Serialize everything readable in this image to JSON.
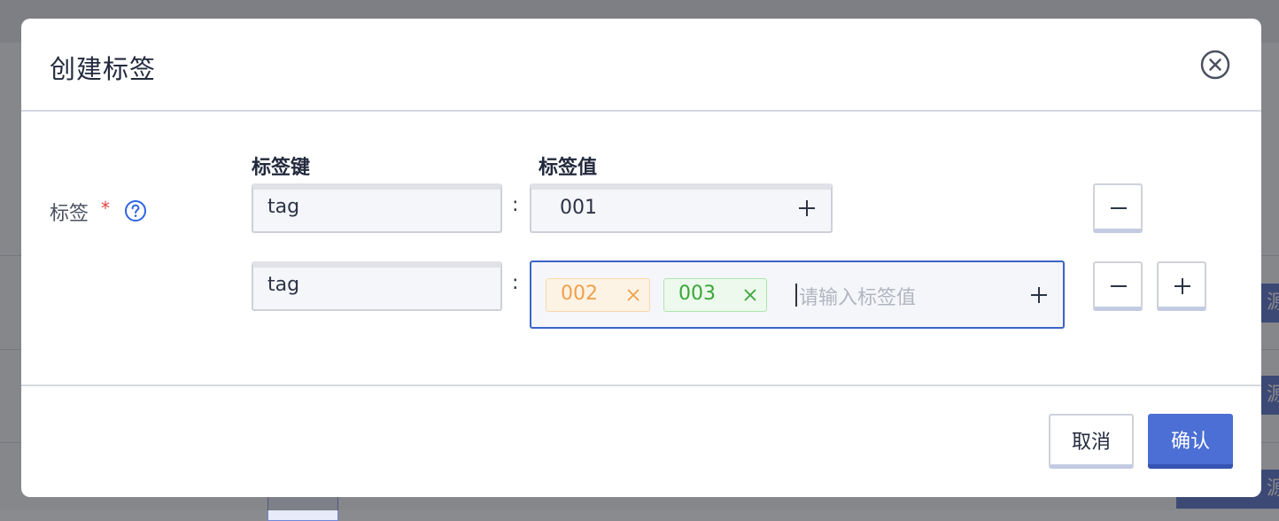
{
  "background": {
    "button_label": "源"
  },
  "modal": {
    "title": "创建标签",
    "form": {
      "label": "标签",
      "required_mark": "*",
      "key_header": "标签键",
      "value_header": "标签值",
      "separator": ":",
      "rows": [
        {
          "key": "tag",
          "value": "001"
        },
        {
          "key": "tag",
          "chips": [
            "002",
            "003"
          ],
          "placeholder": "请输入标签值"
        }
      ]
    },
    "footer": {
      "cancel_label": "取消",
      "confirm_label": "确认"
    }
  },
  "colors": {
    "primary": "#4b6fd4",
    "chip_orange": "#f0a04b",
    "chip_green": "#3aa63a",
    "required": "#e4423b",
    "help": "#2d64e6"
  },
  "icons": [
    "close-circle-icon",
    "help-circle-icon",
    "plus-icon",
    "minus-icon",
    "close-icon"
  ]
}
